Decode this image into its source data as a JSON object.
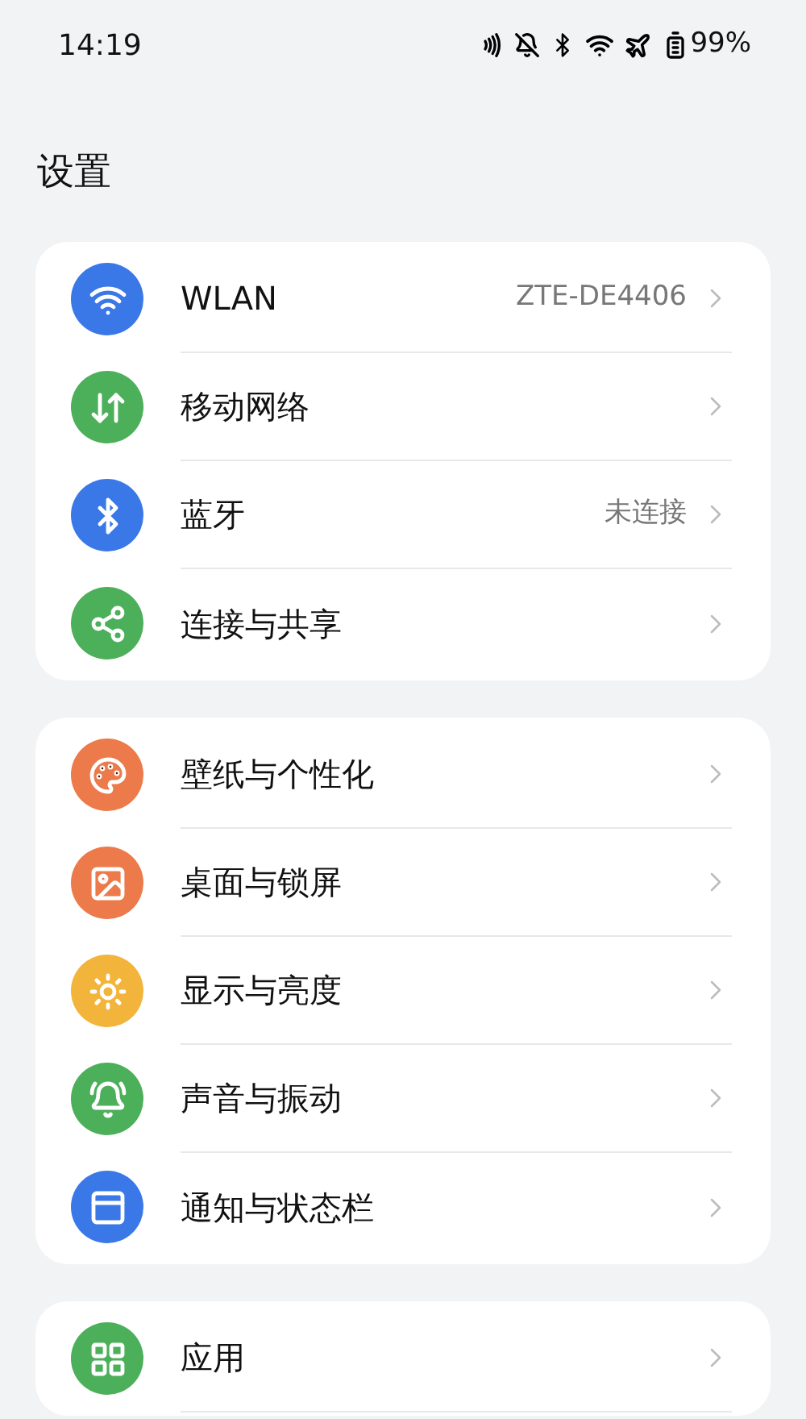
{
  "status_bar": {
    "time": "14:19",
    "battery": "99%"
  },
  "title": "设置",
  "groups": [
    {
      "items": [
        {
          "kind": "wifi",
          "color": "#3a78e8",
          "label": "WLAN",
          "value": "ZTE-DE4406"
        },
        {
          "kind": "mobile",
          "color": "#4caf5a",
          "label": "移动网络"
        },
        {
          "kind": "bluetooth",
          "color": "#3a78e8",
          "label": "蓝牙",
          "value": "未连接"
        },
        {
          "kind": "share",
          "color": "#4caf5a",
          "label": "连接与共享"
        }
      ]
    },
    {
      "items": [
        {
          "kind": "palette",
          "color": "#ec7a4a",
          "label": "壁纸与个性化"
        },
        {
          "kind": "image",
          "color": "#ec7a4a",
          "label": "桌面与锁屏"
        },
        {
          "kind": "sun",
          "color": "#f2b43a",
          "label": "显示与亮度"
        },
        {
          "kind": "bell",
          "color": "#4caf5a",
          "label": "声音与振动"
        },
        {
          "kind": "notification",
          "color": "#3a78e8",
          "label": "通知与状态栏"
        }
      ]
    },
    {
      "items": [
        {
          "kind": "apps",
          "color": "#4caf5a",
          "label": "应用"
        }
      ]
    }
  ]
}
